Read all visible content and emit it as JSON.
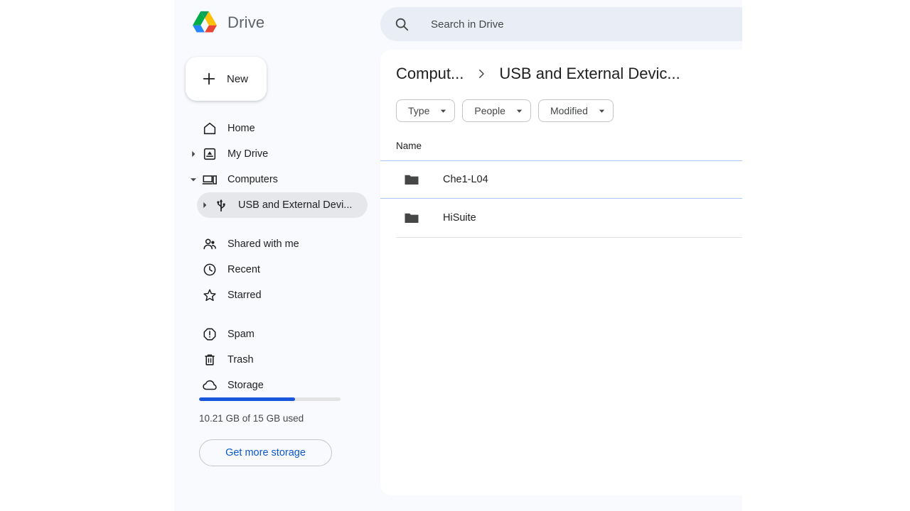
{
  "brand": {
    "name": "Drive",
    "logo_icon": "google-drive-logo",
    "colors": {
      "green": "#0da160",
      "yellow": "#ffc107",
      "blue": "#2684fc",
      "red": "#ea4335",
      "teal": "#00ac47"
    }
  },
  "new_button": {
    "label": "New",
    "icon": "plus-icon"
  },
  "search": {
    "placeholder": "Search in Drive",
    "value": "",
    "icon": "search-icon"
  },
  "sidebar": {
    "items": [
      {
        "label": "Home",
        "icon": "home-icon",
        "caret": "none",
        "selected": false,
        "child": false
      },
      {
        "label": "My Drive",
        "icon": "my-drive-icon",
        "caret": "collapsed",
        "selected": false,
        "child": false
      },
      {
        "label": "Computers",
        "icon": "computer-icon",
        "caret": "expanded",
        "selected": false,
        "child": false
      },
      {
        "label": "USB and External Devi...",
        "icon": "usb-icon",
        "caret": "collapsed",
        "selected": true,
        "child": true
      },
      {
        "label": "Shared with me",
        "icon": "people-icon",
        "caret": "none",
        "selected": false,
        "child": false
      },
      {
        "label": "Recent",
        "icon": "clock-icon",
        "caret": "none",
        "selected": false,
        "child": false
      },
      {
        "label": "Starred",
        "icon": "star-icon",
        "caret": "none",
        "selected": false,
        "child": false
      },
      {
        "label": "Spam",
        "icon": "spam-icon",
        "caret": "none",
        "selected": false,
        "child": false
      },
      {
        "label": "Trash",
        "icon": "trash-icon",
        "caret": "none",
        "selected": false,
        "child": false
      },
      {
        "label": "Storage",
        "icon": "cloud-icon",
        "caret": "none",
        "selected": false,
        "child": false
      }
    ]
  },
  "storage": {
    "used_text": "10.21 GB of 15 GB used",
    "used_gb": 10.21,
    "total_gb": 15,
    "percent": 68,
    "fill_color": "#1a56db",
    "button_label": "Get more storage"
  },
  "breadcrumb": {
    "items": [
      "Comput...",
      "USB and External Devic..."
    ],
    "separator_icon": "chevron-right-icon"
  },
  "filters": {
    "chips": [
      {
        "label": "Type",
        "caret_icon": "chevron-down-icon"
      },
      {
        "label": "People",
        "caret_icon": "chevron-down-icon"
      },
      {
        "label": "Modified",
        "caret_icon": "chevron-down-icon"
      }
    ]
  },
  "file_list": {
    "column_header": "Name",
    "rows": [
      {
        "name": "Che1-L04",
        "icon": "folder-icon",
        "selected": true
      },
      {
        "name": "HiSuite",
        "icon": "folder-icon",
        "selected": false
      }
    ]
  }
}
